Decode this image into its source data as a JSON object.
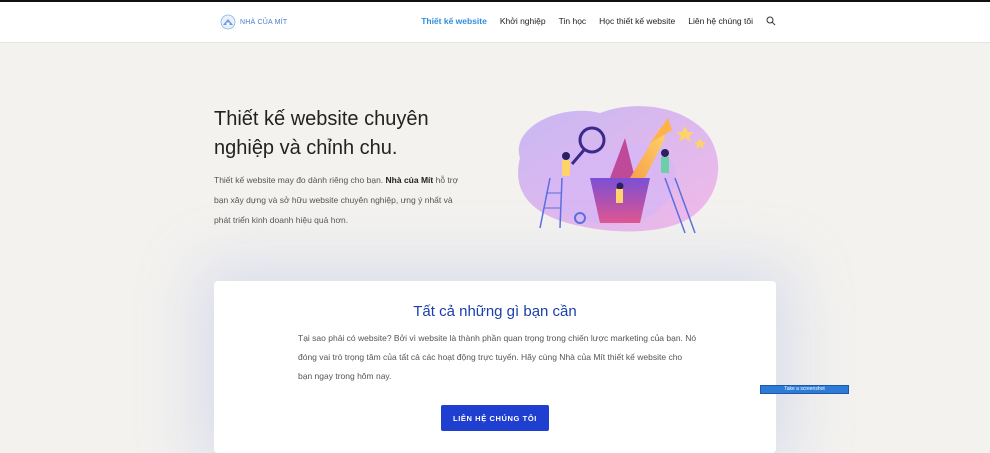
{
  "header": {
    "logo_text": "NHÀ CỦA MÍT",
    "nav": [
      {
        "label": "Thiết kế website",
        "active": true
      },
      {
        "label": "Khởi nghiệp",
        "active": false
      },
      {
        "label": "Tin học",
        "active": false
      },
      {
        "label": "Học thiết kế website",
        "active": false
      },
      {
        "label": "Liên hệ chúng tôi",
        "active": false
      }
    ],
    "search_icon": "search-icon"
  },
  "hero": {
    "title": "Thiết kế website chuyên nghiệp và chỉnh chu.",
    "desc_prefix": "Thiết kế website may đo dành riêng cho bạn. ",
    "desc_brand": "Nhà của Mít",
    "desc_suffix": " hỗ trợ bạn xây dựng và sở hữu website chuyên nghiệp, ưng ý nhất và phát triển kinh doanh hiệu quả hơn."
  },
  "card": {
    "title": "Tất cả những gì bạn cần",
    "text": "Tại sao phải có website? Bởi vì website là thành phần quan trọng trong chiến lược marketing của bạn. Nó đóng vai trò trọng tâm của tất cả các hoạt động trực tuyến. Hãy cùng Nhà của Mít thiết kế website cho bạn ngay trong hôm nay.",
    "cta_label": "LIÊN HỆ CHÚNG TÔI"
  },
  "overlay": {
    "screenshot_tip": "Take a screenshot"
  },
  "colors": {
    "accent": "#2e8fe0",
    "card_title": "#1a3faa",
    "cta": "#1f3fd0",
    "page_bg": "#f3f2ef"
  }
}
